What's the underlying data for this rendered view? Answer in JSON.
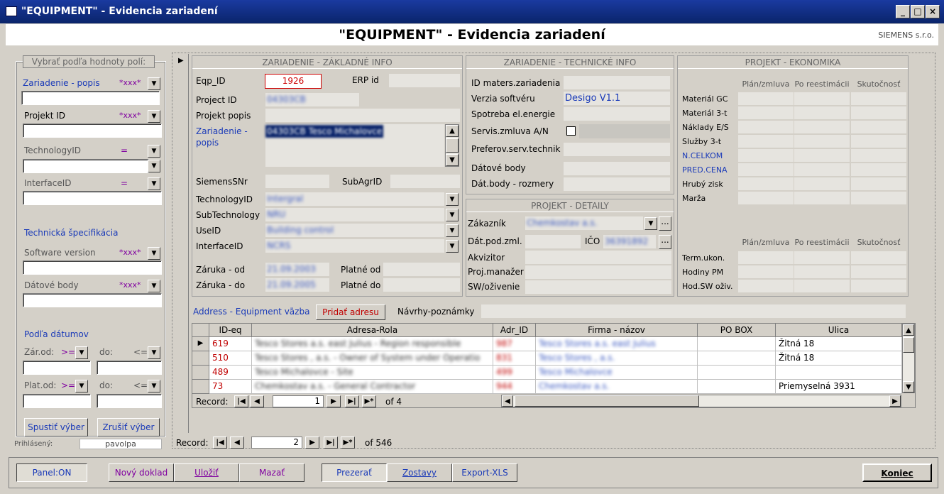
{
  "window": {
    "title": "\"EQUIPMENT\" - Evidencia zariadení",
    "min": "_",
    "max": "□",
    "close": "×"
  },
  "header": {
    "title": "\"EQUIPMENT\" - Evidencia zariadení",
    "company": "SIEMENS s.r.o."
  },
  "filter": {
    "group_title": "Vybrať podľa hodnoty polí:",
    "zariadenie_label": "Zariadenie - popis",
    "zariadenie_op": "*xxx*",
    "projekt_label": "Projekt ID",
    "projekt_op": "*xxx*",
    "technology_label": "TechnologyID",
    "technology_op": "=",
    "interface_label": "InterfaceID",
    "interface_op": "=",
    "tech_spec": "Technická špecifikácia",
    "software_label": "Software version",
    "software_op": "*xxx*",
    "datove_label": "Dátové body",
    "datove_op": "*xxx*",
    "podla_datumov": "Podľa dátumov",
    "zar_od": "Zár.od:",
    "plat_od": "Plat.od:",
    "op_ge": ">=",
    "op_le": "<=",
    "do": "do:",
    "run": "Spustiť výber",
    "cancel": "Zrušiť výber",
    "login_label": "Prihlásený:",
    "login_user": "pavolpa"
  },
  "basic": {
    "title": "ZARIADENIE - ZÁKLADNÉ INFO",
    "eqp_label": "Eqp_ID",
    "eqp_value": "1926",
    "erp_label": "ERP id",
    "project_label": "Project ID",
    "project_value": "04303CB",
    "projekt_popis_label": "Projekt popis",
    "zar_popis_label": "Zariadenie - popis",
    "zar_popis_value": "04303CB Tesco Michalovce",
    "siemens_label": "SiemensSNr",
    "subagr_label": "SubAgrID",
    "technology_label": "TechnologyID",
    "technology_value": "Intergral",
    "subtech_label": "SubTechnology",
    "subtech_value": "NRU",
    "use_label": "UseID",
    "use_value": "Building control",
    "interface_label": "InterfaceID",
    "interface_value": "NCRS",
    "zaruka_od_label": "Záruka - od",
    "zaruka_od_value": "21.09.2003",
    "zaruka_do_label": "Záruka - do",
    "zaruka_do_value": "21.09.2005",
    "platne_od_label": "Platné od",
    "platne_do_label": "Platné do"
  },
  "tech": {
    "title": "ZARIADENIE - TECHNICKÉ INFO",
    "materials": "ID maters.zariadenia",
    "software": "Verzia softvéru",
    "software_value": "Desigo V1.1",
    "energia": "Spotreba el.energie",
    "servis": "Servis.zmluva A/N",
    "technik": "Preferov.serv.technik",
    "datove": "Dátové body",
    "rozmery": "Dát.body - rozmery"
  },
  "detail": {
    "title": "PROJEKT - DETAILY",
    "zakaznik": "Zákazník",
    "zakaznik_value": "Chemkostav a.s.",
    "datpod": "Dát.pod.zml.",
    "ico": "IČO",
    "ico_value": "36391892",
    "akvizitor": "Akvizitor",
    "manazer": "Proj.manažer",
    "sw": "SW/oživenie"
  },
  "econ": {
    "title": "PROJEKT - EKONOMIKA",
    "cols": [
      "Plán/zmluva",
      "Po reestimácii",
      "Skutočnosť"
    ],
    "rows": [
      "Materiál GC",
      "Materiál 3-t",
      "Náklady E/S",
      "Služby 3-t",
      "N.CELKOM",
      "PRED.CENA",
      "Hrubý zisk",
      "Marža"
    ],
    "rows2": [
      "Term.ukon.",
      "Hodiny PM",
      "Hod.SW oživ."
    ]
  },
  "address": {
    "label": "Address - Equipment väzba",
    "add_button": "Pridať adresu",
    "notes_label": "Návrhy-poznámky",
    "columns": [
      "ID-eq",
      "Adresa-Rola",
      "Adr_ID",
      "Firma - názov",
      "PO BOX",
      "Ulica"
    ],
    "rows": [
      [
        "619",
        "Tesco Stores a.s. east Julius - Region responsible",
        "987",
        "Tesco Stores a.s. east Julius",
        "",
        "Žitná 18"
      ],
      [
        "510",
        "Tesco Stores , a.s. - Owner of System under Operatio",
        "831",
        "Tesco Stores , a.s.",
        "",
        "Žitná 18"
      ],
      [
        "489",
        "Tesco Michalovce - Site",
        "499",
        "Tesco Michalovce",
        "",
        ""
      ],
      [
        "73",
        "Chemkostav a.s. - General Contractor",
        "944",
        "Chemkostav a.s.",
        "",
        "Priemyselná 3931"
      ]
    ],
    "record_label": "Record:",
    "record_num": "1",
    "record_of": "of 4"
  },
  "main_nav": {
    "record_label": "Record:",
    "record_num": "2",
    "record_of": "of 546"
  },
  "bottom": {
    "panel": "Panel:ON",
    "novy": "Nový doklad",
    "ulozit": "Uložiť",
    "mazat": "Mazať",
    "prezerat": "Prezerať",
    "zostavy": "Zostavy",
    "export": "Export-XLS",
    "koniec": "Koniec"
  }
}
